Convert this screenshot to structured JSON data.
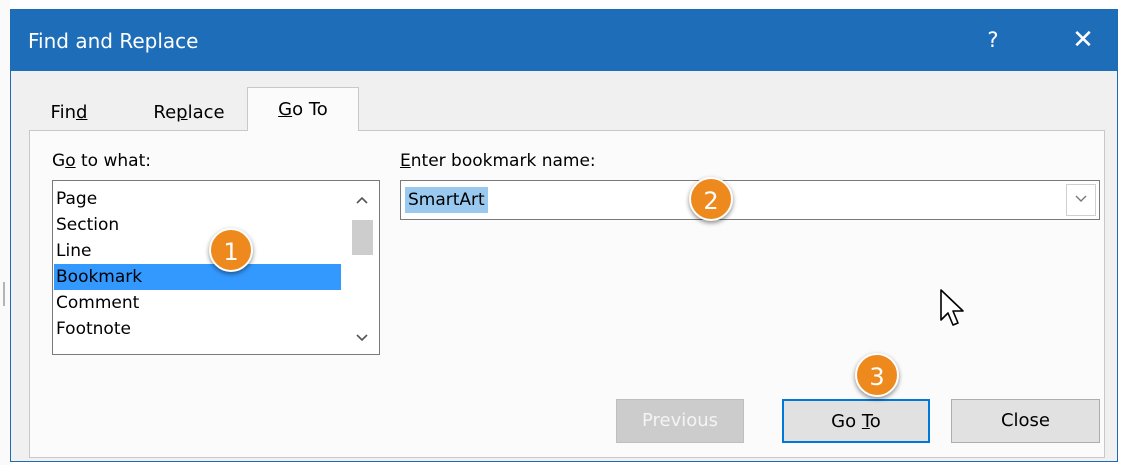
{
  "window": {
    "title": "Find and Replace",
    "help_label": "?",
    "close_glyph": "✕",
    "titlebar_color": "#1e6db8"
  },
  "tabs": [
    {
      "label": "Find",
      "accesskey": "d",
      "selected": false
    },
    {
      "label": "Replace",
      "accesskey": "p",
      "selected": false
    },
    {
      "label": "Go To",
      "accesskey": "G",
      "selected": true
    }
  ],
  "goto_what": {
    "label": "Go to what:",
    "items": [
      "Page",
      "Section",
      "Line",
      "Bookmark",
      "Comment",
      "Footnote"
    ],
    "selected": "Bookmark"
  },
  "bookmark": {
    "label": "Enter bookmark name:",
    "value": "SmartArt"
  },
  "buttons": {
    "previous": "Previous",
    "goto": "Go To",
    "close": "Close"
  },
  "callouts": [
    "1",
    "2",
    "3"
  ],
  "colors": {
    "accent": "#0078d7",
    "selection": "#3399ff",
    "callout": "#ee8a1d"
  },
  "icons": {
    "scroll_up": "chevron-up-icon",
    "scroll_down": "chevron-down-icon",
    "dropdown": "chevron-down-icon",
    "cursor": "mouse-pointer-icon"
  }
}
